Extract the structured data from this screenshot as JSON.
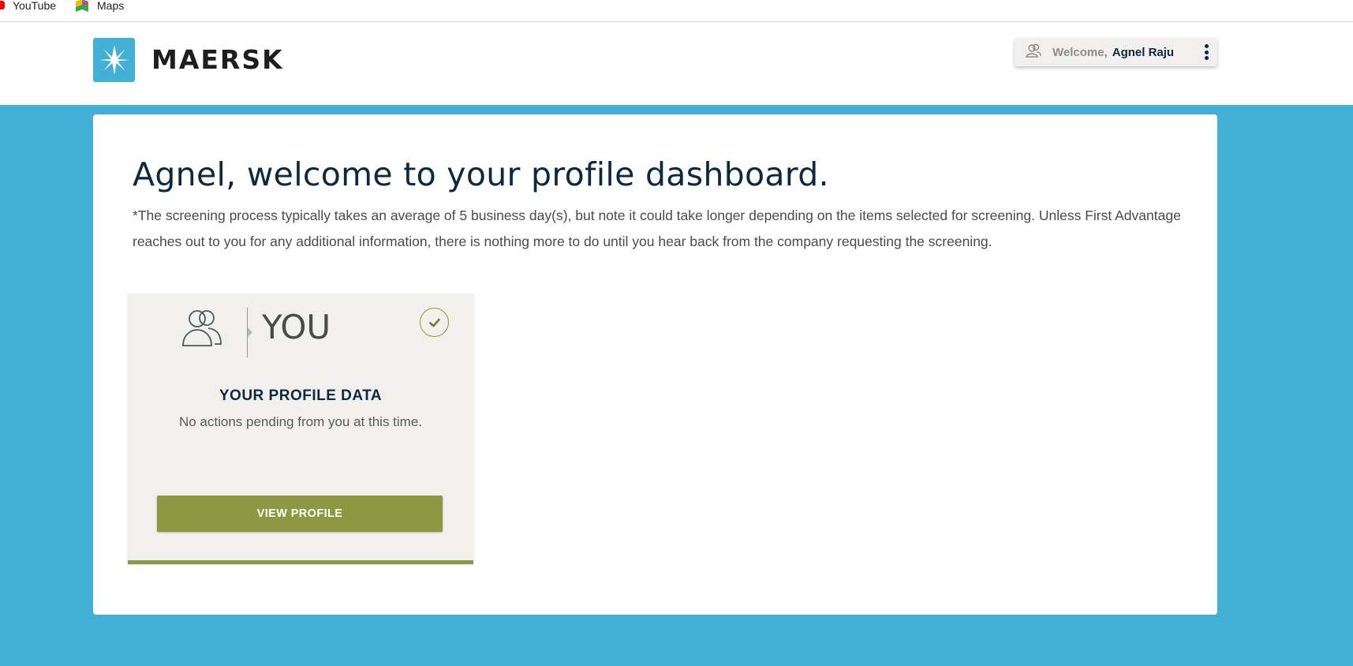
{
  "bookmarks": [
    {
      "label": "YouTube",
      "icon": "youtube-icon"
    },
    {
      "label": "Maps",
      "icon": "maps-icon"
    }
  ],
  "header": {
    "brand": "MAERSK",
    "logo_icon": "star-icon",
    "welcome_label": "Welcome,",
    "user_name": "Agnel Raju",
    "user_icon": "user-icon",
    "menu_icon": "kebab-menu-icon"
  },
  "main": {
    "title": "Agnel, welcome to your profile dashboard.",
    "note": "*The screening process typically takes an average of 5 business day(s), but note it could take longer depending on the items selected for screening. Unless First Advantage reaches out to you for any additional information, there is nothing more to do until you hear back from the company requesting the screening.",
    "tile": {
      "label": "YOU",
      "heading": "YOUR PROFILE DATA",
      "status": "No actions pending from you at this time.",
      "button_label": "VIEW PROFILE",
      "icon": "users-icon",
      "status_icon": "check-circle-icon"
    }
  },
  "colors": {
    "brand_blue": "#42b0d5",
    "olive": "#8c9842",
    "navy": "#0b2a40"
  }
}
